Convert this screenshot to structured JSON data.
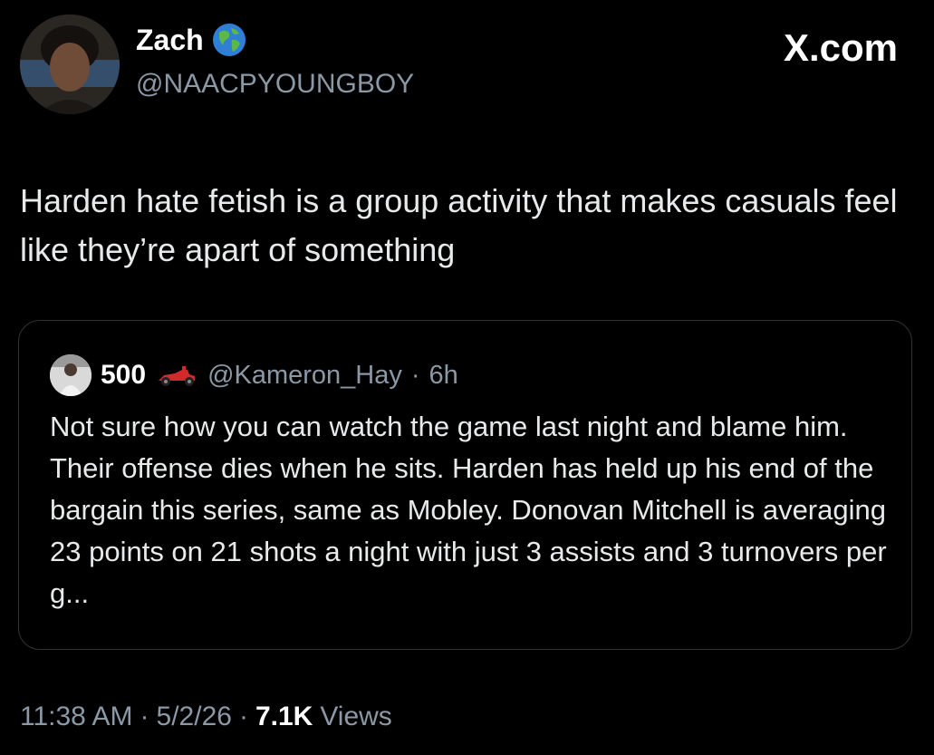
{
  "author": {
    "display_name": "Zach",
    "handle": "@NAACPYOUNGBOY",
    "badge_icon": "globe-icon"
  },
  "watermark": "X.com",
  "tweet": {
    "text": "Harden hate fetish is a group activity that makes casuals feel like they’re apart of something"
  },
  "quote": {
    "display_name": "500",
    "name_icon": "race-car-icon",
    "handle": "@Kameron_Hay",
    "separator": "·",
    "time": "6h",
    "text": "Not sure how you can watch the game last night and blame him. Their offense dies when he sits. Harden has held up his end of the bargain this series, same as Mobley. Donovan Mitchell is averaging 23 points on 21 shots a night with just 3 assists and 3 turnovers per g..."
  },
  "meta": {
    "time": "11:38 AM",
    "sep1": "·",
    "date": "5/2/26",
    "sep2": "·",
    "views_count": "7.1K",
    "views_label": "Views"
  },
  "colors": {
    "background": "#000000",
    "text": "#e7e9ea",
    "secondary": "#8b98a5",
    "border": "#2f3336"
  }
}
